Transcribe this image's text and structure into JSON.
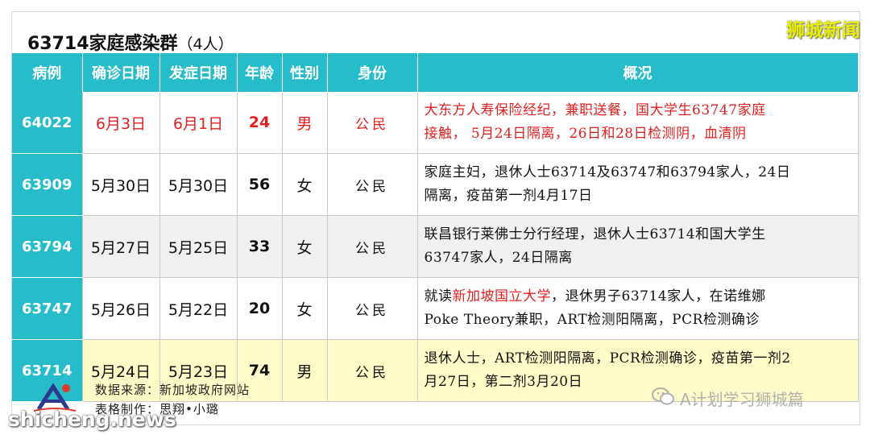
{
  "title": {
    "main": "63714家庭感染群",
    "count": "（4人）"
  },
  "watermark_top": "狮城新闻",
  "headers": [
    "病例",
    "确诊日期",
    "发症日期",
    "年龄",
    "性别",
    "身份",
    "概况"
  ],
  "rows": [
    {
      "id": "64022",
      "confirmed": "6月3日",
      "onset": "6月1日",
      "age": "24",
      "gender": "男",
      "status": "公民",
      "summary_line1": "大东方人寿保险经纪，兼职送餐，国大学生63747家庭",
      "summary_line2": "接触， 5月24日隔离，26日和28日检测阴，血清阴"
    },
    {
      "id": "63909",
      "confirmed": "5月30日",
      "onset": "5月30日",
      "age": "56",
      "gender": "女",
      "status": "公民",
      "summary_line1": "家庭主妇，退休人士63714及63747和63794家人，24日",
      "summary_line2": "隔离，疫苗第一剂4月17日"
    },
    {
      "id": "63794",
      "confirmed": "5月27日",
      "onset": "5月25日",
      "age": "33",
      "gender": "女",
      "status": "公民",
      "summary_line1": "联昌银行莱佛士分行经理，退休人士63714和国大学生",
      "summary_line2": "63747家人，24日隔离"
    },
    {
      "id": "63747",
      "confirmed": "5月26日",
      "onset": "5月22日",
      "age": "20",
      "gender": "女",
      "status": "公民",
      "summary_pre": "就读",
      "summary_hl": "新加坡国立大学",
      "summary_post": "，退休男子63714家人，在诺维娜",
      "summary_line2": "Poke Theory兼职，ART检测阳隔离，PCR检测确诊"
    },
    {
      "id": "63714",
      "confirmed": "5月24日",
      "onset": "5月23日",
      "age": "74",
      "gender": "男",
      "status": "公民",
      "summary_line1": "退休人士，ART检测阳隔离，PCR检测确诊，疫苗第一剂2",
      "summary_line2": "月27日，第二剂3月20日"
    }
  ],
  "footer": {
    "source": "数据来源：新加坡政府网站",
    "maker": "表格制作：思翔•小璐",
    "wechat_name": "A计划学习狮城篇",
    "wechat_icon": "wechat-icon",
    "logo_icon": "a-plan-logo-icon"
  },
  "watermark_bottom": "shicheng.news",
  "colors": {
    "header": "#26bcc9",
    "highlight": "#e02020",
    "last_row": "#fffbc8"
  }
}
